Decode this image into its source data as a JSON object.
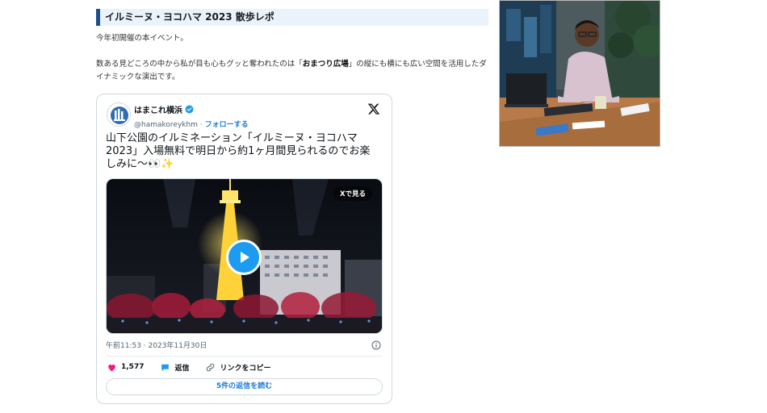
{
  "article": {
    "heading": "イルミーヌ・ヨコハマ 2023 散歩レポ",
    "para1": "今年初開催の本イベント。",
    "para2_before": "数ある見どころの中から私が目も心もグッと奪われたのは「",
    "para2_bold": "おまつり広場",
    "para2_after": "」の縦にも横にも広い空間を活用したダイナミックな演出です。"
  },
  "tweet": {
    "display_name": "はまこれ横浜",
    "handle": "@hamakoreykhm",
    "separator": "·",
    "follow_label": "フォローする",
    "text": "山下公園のイルミネーション「イルミーヌ・ヨコハマ2023」入場無料で明日から約1ヶ月間見られるのでお楽しみに〜👀✨",
    "media_button": "Xで見る",
    "timestamp": "午前11:53 · 2023年11月30日",
    "likes": "1,577",
    "reply_label": "返信",
    "copy_link_label": "リンクをコピー",
    "read_replies_label": "5件の返信を読む"
  },
  "colors": {
    "accent": "#1d9bf0",
    "heart": "#f91880",
    "heading_bar": "#1b4f8a"
  },
  "icons": [
    "verified-badge-icon",
    "x-logo-icon",
    "play-icon",
    "info-icon",
    "heart-icon",
    "reply-bubble-icon",
    "link-icon"
  ]
}
